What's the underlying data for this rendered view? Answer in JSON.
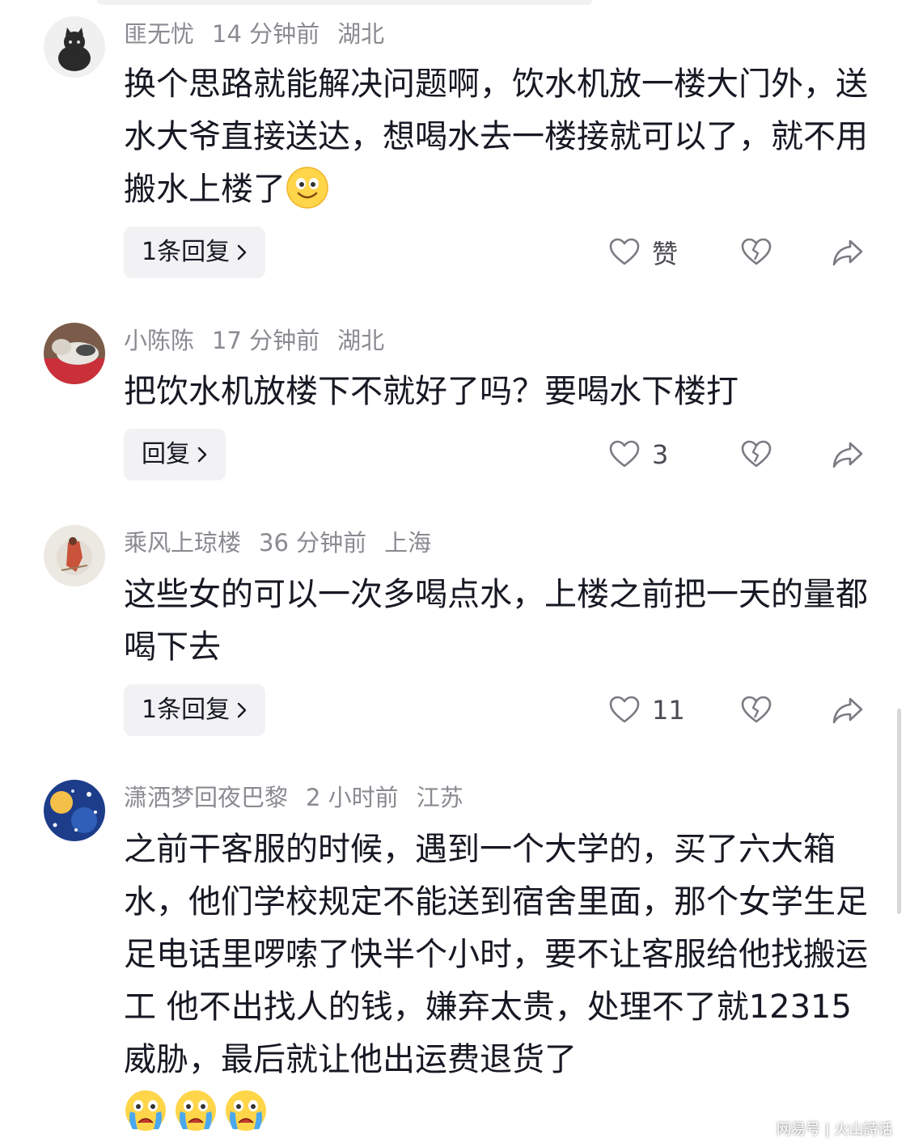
{
  "comments": [
    {
      "author": "匪无忧",
      "time": "14 分钟前",
      "location": "湖北",
      "text": "换个思路就能解决问题啊，饮水机放一楼大门外，送水大爷直接送达，想喝水去一楼接就可以了，就不用搬水上楼了",
      "emojis": [
        "smile-emoji"
      ],
      "reply_label": "1条回复",
      "like_label": "赞"
    },
    {
      "author": "小陈陈",
      "time": "17 分钟前",
      "location": "湖北",
      "text": "把饮水机放楼下不就好了吗？要喝水下楼打",
      "reply_label": "回复",
      "like_label": "3"
    },
    {
      "author": "乘风上琼楼",
      "time": "36 分钟前",
      "location": "上海",
      "text": "这些女的可以一次多喝点水，上楼之前把一天的量都喝下去",
      "reply_label": "1条回复",
      "like_label": "11"
    },
    {
      "author": "潇洒梦回夜巴黎",
      "time": "2 小时前",
      "location": "江苏",
      "text": "之前干客服的时候，遇到一个大学的，买了六大箱水，他们学校规定不能送到宿舍里面，那个女学生足足电话里啰嗦了快半个小时，要不让客服给他找搬运工 他不出找人的钱，嫌弃太贵，处理不了就12315威胁，最后就让他出运费退货了",
      "emojis": [
        "crying-emoji",
        "crying-emoji",
        "crying-emoji"
      ]
    }
  ],
  "watermark": "网易号 | 火山詩话",
  "colors": {
    "meta_gray": "#8a8b91",
    "text": "#161823",
    "button_bg": "#f2f2f4",
    "icon_gray": "#7a7b82"
  }
}
